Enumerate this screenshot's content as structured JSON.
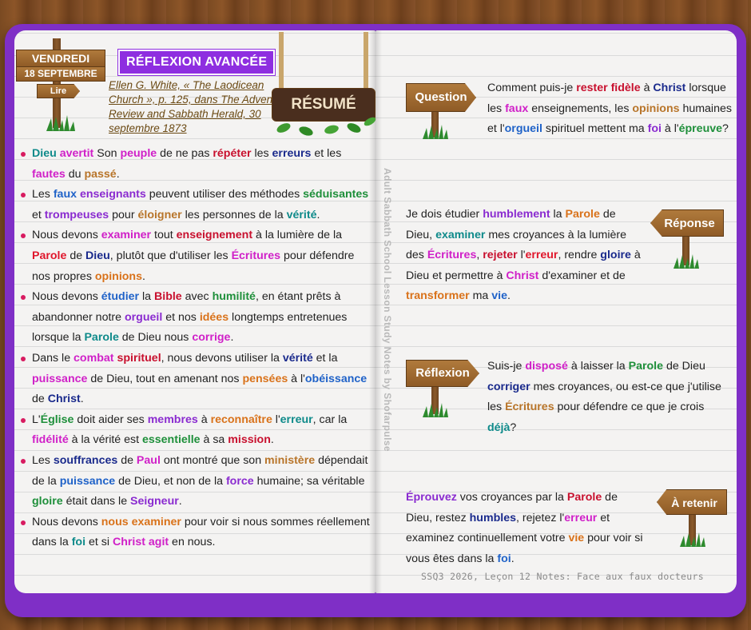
{
  "header": {
    "day": "VENDREDI",
    "date": "18 SEPTEMBRE",
    "read": "Lire",
    "section_tag": "RÉFLEXION AVANCÉE",
    "reference": "Ellen G. White, « The Laodicean Church », p. 125, dans The Advent Review and Sabbath Herald, 30 septembre 1873",
    "summary_sign": "RÉSUMÉ"
  },
  "bullets": [
    [
      [
        "Dieu",
        "teal"
      ],
      [
        " "
      ],
      [
        "avertit",
        "mag"
      ],
      [
        " Son "
      ],
      [
        "peuple",
        "mag"
      ],
      [
        " de ne pas "
      ],
      [
        "répéter",
        "crim"
      ],
      [
        " les "
      ],
      [
        "erreurs",
        "navy"
      ],
      [
        " et les "
      ],
      [
        "fautes",
        "mag"
      ],
      [
        " du "
      ],
      [
        "passé",
        "brown"
      ],
      [
        "."
      ]
    ],
    [
      [
        "Les "
      ],
      [
        "faux",
        "blue"
      ],
      [
        " "
      ],
      [
        "enseignants",
        "purple"
      ],
      [
        " peuvent utiliser des méthodes "
      ],
      [
        "séduisantes",
        "green"
      ],
      [
        " et "
      ],
      [
        "trompeuses",
        "purple"
      ],
      [
        " pour "
      ],
      [
        "éloigner",
        "brown"
      ],
      [
        " les personnes de la "
      ],
      [
        "vérité",
        "teal"
      ],
      [
        "."
      ]
    ],
    [
      [
        "Nous devons "
      ],
      [
        "examiner",
        "mag"
      ],
      [
        " tout "
      ],
      [
        "enseignement",
        "crim"
      ],
      [
        " à la lumière de la "
      ],
      [
        "Parole",
        "red"
      ],
      [
        " de "
      ],
      [
        "Dieu",
        "navy"
      ],
      [
        ", plutôt que d'utiliser les "
      ],
      [
        "Écritures",
        "mag"
      ],
      [
        " pour défendre nos propres "
      ],
      [
        "opinions",
        "orange"
      ],
      [
        "."
      ]
    ],
    [
      [
        "Nous devons "
      ],
      [
        "étudier",
        "blue"
      ],
      [
        " la "
      ],
      [
        "Bible",
        "crim"
      ],
      [
        " avec "
      ],
      [
        "humilité",
        "green"
      ],
      [
        ", en étant prêts à abandonner notre "
      ],
      [
        "orgueil",
        "purple"
      ],
      [
        " et nos "
      ],
      [
        "idées",
        "orange"
      ],
      [
        " longtemps entretenues lorsque la "
      ],
      [
        "Parole",
        "teal"
      ],
      [
        " de Dieu nous "
      ],
      [
        "corrige",
        "mag"
      ],
      [
        "."
      ]
    ],
    [
      [
        "Dans le "
      ],
      [
        "combat",
        "mag"
      ],
      [
        " "
      ],
      [
        "spirituel",
        "crim"
      ],
      [
        ", nous devons utiliser la "
      ],
      [
        "vérité",
        "navy"
      ],
      [
        " et la "
      ],
      [
        "puissance",
        "mag"
      ],
      [
        " de Dieu, tout en amenant nos "
      ],
      [
        "pensées",
        "orange"
      ],
      [
        " à l'"
      ],
      [
        "obéissance",
        "blue"
      ],
      [
        " de "
      ],
      [
        "Christ",
        "navy"
      ],
      [
        "."
      ]
    ],
    [
      [
        "L'"
      ],
      [
        "Église",
        "green"
      ],
      [
        " doit aider ses "
      ],
      [
        "membres",
        "purple"
      ],
      [
        " à "
      ],
      [
        "reconnaître",
        "orange"
      ],
      [
        " l'"
      ],
      [
        "erreur",
        "teal"
      ],
      [
        ", car la "
      ],
      [
        "fidélité",
        "mag"
      ],
      [
        " à la vérité est "
      ],
      [
        "essentielle",
        "green"
      ],
      [
        " à sa "
      ],
      [
        "mission",
        "crim"
      ],
      [
        "."
      ]
    ],
    [
      [
        "Les "
      ],
      [
        "souffrances",
        "navy"
      ],
      [
        " de "
      ],
      [
        "Paul",
        "mag"
      ],
      [
        " ont montré que son "
      ],
      [
        "ministère",
        "brown"
      ],
      [
        " dépendait de la "
      ],
      [
        "puissance",
        "blue"
      ],
      [
        " de Dieu, et non de la "
      ],
      [
        "force",
        "purple"
      ],
      [
        " humaine; sa véritable "
      ],
      [
        "gloire",
        "green"
      ],
      [
        " était dans le "
      ],
      [
        "Seigneur",
        "purple"
      ],
      [
        "."
      ]
    ],
    [
      [
        "Nous devons "
      ],
      [
        "nous examiner",
        "orange"
      ],
      [
        " pour voir si nous sommes réellement dans la "
      ],
      [
        "foi",
        "teal"
      ],
      [
        " et si "
      ],
      [
        "Christ agit",
        "mag"
      ],
      [
        " en nous."
      ]
    ]
  ],
  "vertical_text": "Adult Sabbath School Lesson Study Notes by Shofarpulse",
  "signs": {
    "question": "Question",
    "answer": "Réponse",
    "reflection": "Réflexion",
    "retain": "À retenir"
  },
  "question_text": [
    [
      "Comment puis-je "
    ],
    [
      "rester fidèle",
      "crim"
    ],
    [
      " à "
    ],
    [
      "Christ",
      "navy"
    ],
    [
      " lorsque les "
    ],
    [
      "faux",
      "mag"
    ],
    [
      " enseignements, les "
    ],
    [
      "opinions",
      "brown"
    ],
    [
      " humaines et l'"
    ],
    [
      "orgueil",
      "blue"
    ],
    [
      " spirituel mettent ma "
    ],
    [
      "foi",
      "purple"
    ],
    [
      " à l'"
    ],
    [
      "épreuve",
      "green"
    ],
    [
      "?"
    ]
  ],
  "answer_text": [
    [
      "Je dois étudier "
    ],
    [
      "humblement",
      "purple"
    ],
    [
      " la "
    ],
    [
      "Parole",
      "orange"
    ],
    [
      " de Dieu, "
    ],
    [
      "examiner",
      "teal"
    ],
    [
      " mes croyances à la lumière des "
    ],
    [
      "Écritures",
      "mag"
    ],
    [
      ", "
    ],
    [
      "rejeter",
      "crim"
    ],
    [
      " l'"
    ],
    [
      "erreur",
      "red"
    ],
    [
      ", rendre "
    ],
    [
      "gloire",
      "navy"
    ],
    [
      " à Dieu et permettre à "
    ],
    [
      "Christ",
      "mag"
    ],
    [
      " d'examiner et de "
    ],
    [
      "transformer",
      "orange"
    ],
    [
      " ma "
    ],
    [
      "vie",
      "blue"
    ],
    [
      "."
    ]
  ],
  "reflection_text": [
    [
      "Suis-je "
    ],
    [
      "disposé",
      "mag"
    ],
    [
      " à laisser la "
    ],
    [
      "Parole",
      "green"
    ],
    [
      " de Dieu "
    ],
    [
      "corriger",
      "navy"
    ],
    [
      " mes croyances, ou est-ce que j'utilise les "
    ],
    [
      "Écritures",
      "brown"
    ],
    [
      " pour défendre ce que je crois "
    ],
    [
      "déjà",
      "teal"
    ],
    [
      "?"
    ]
  ],
  "retain_text": [
    [
      "Éprouvez",
      "purple"
    ],
    [
      " vos croyances par la "
    ],
    [
      "Parole",
      "crim"
    ],
    [
      " de Dieu, restez "
    ],
    [
      "humbles",
      "navy"
    ],
    [
      ", rejetez l'"
    ],
    [
      "erreur",
      "mag"
    ],
    [
      " et examinez continuellement votre "
    ],
    [
      "vie",
      "orange"
    ],
    [
      " pour voir si vous êtes dans la "
    ],
    [
      "foi",
      "blue"
    ],
    [
      "."
    ]
  ],
  "footer": "SSQ3 2026, Leçon 12 Notes: Face aux faux docteurs"
}
